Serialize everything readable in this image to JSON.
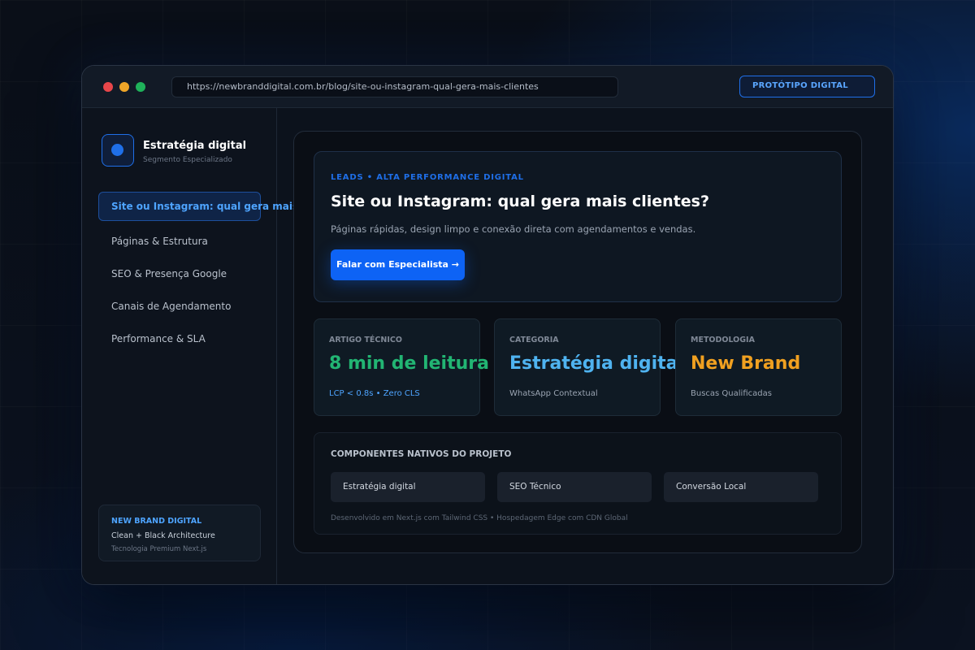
{
  "titlebar": {
    "url": "https://newbranddigital.com.br/blog/site-ou-instagram-qual-gera-mais-clientes",
    "badge": "PROTÓTIPO DIGITAL"
  },
  "sidebar": {
    "brand_title": "Estratégia digital",
    "brand_subtitle": "Segmento Especializado",
    "items": [
      {
        "label": "Site ou Instagram: qual gera mais clientes?",
        "active": true
      },
      {
        "label": "Páginas & Estrutura",
        "active": false
      },
      {
        "label": "SEO & Presença Google",
        "active": false
      },
      {
        "label": "Canais de Agendamento",
        "active": false
      },
      {
        "label": "Performance & SLA",
        "active": false
      }
    ],
    "card": {
      "title": "NEW BRAND DIGITAL",
      "line1": "Clean + Black Architecture",
      "line2": "Tecnologia Premium Next.js"
    }
  },
  "hero": {
    "tag": "LEADS • ALTA PERFORMANCE DIGITAL",
    "title": "Site ou Instagram: qual gera mais clientes?",
    "description": "Páginas rápidas, design limpo e conexão direta com agendamentos e vendas.",
    "cta": "Falar com Especialista →"
  },
  "stats": [
    {
      "label": "ARTIGO TÉCNICO",
      "value": "8 min de leitura",
      "sub": "LCP < 0.8s • Zero CLS",
      "value_color": "#22b573",
      "sub_color": "#4ea4ff"
    },
    {
      "label": "CATEGORIA",
      "value": "Estratégia digital",
      "sub": "WhatsApp Contextual",
      "value_color": "#4fb3f0",
      "sub_color": "#9aa4b2"
    },
    {
      "label": "METODOLOGIA",
      "value": "New Brand",
      "sub": "Buscas Qualificadas",
      "value_color": "#f0a020",
      "sub_color": "#9aa4b2"
    }
  ],
  "components": {
    "heading": "COMPONENTES NATIVOS DO PROJETO",
    "chips": [
      "Estratégia digital",
      "SEO Técnico",
      "Conversão Local"
    ],
    "footer": "Desenvolvido em Next.js com Tailwind CSS • Hospedagem Edge com CDN Global"
  },
  "colors": {
    "accent": "#0d63f5",
    "background": "#0a0f18"
  }
}
